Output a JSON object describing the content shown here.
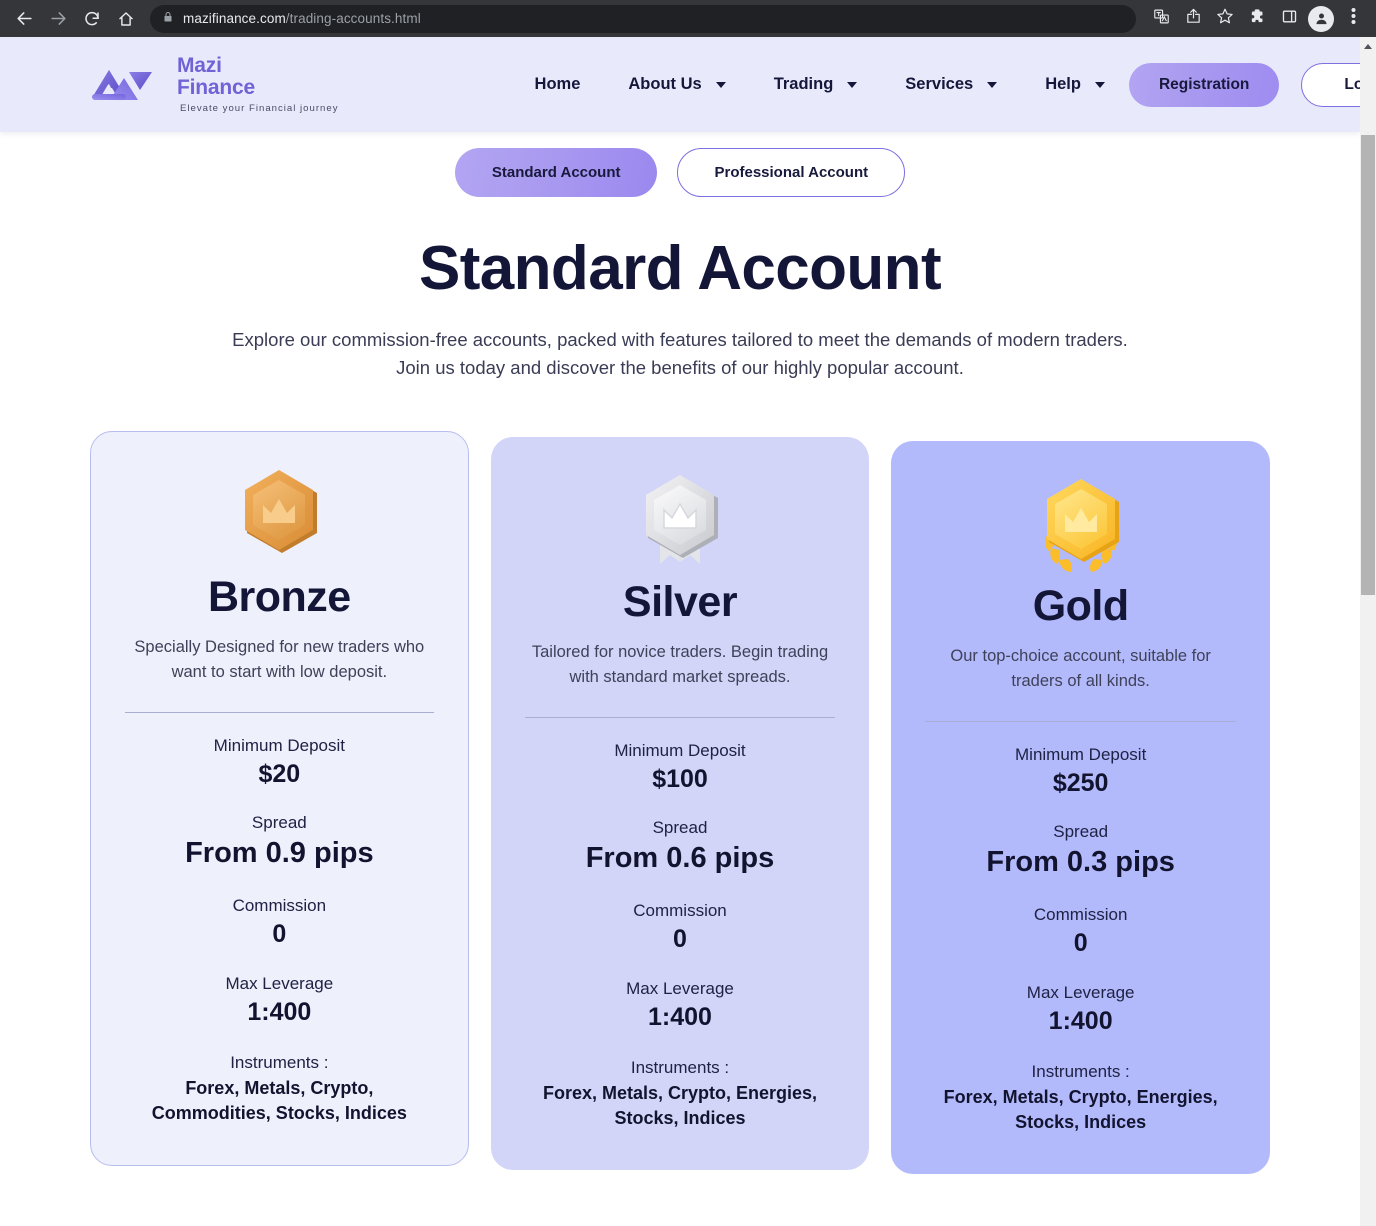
{
  "browser": {
    "url_domain": "mazifinance.com",
    "url_path": "/trading-accounts.html",
    "back_icon": "back-arrow-icon",
    "forward_icon": "forward-arrow-icon",
    "reload_icon": "reload-icon",
    "home_icon": "home-icon",
    "lock_icon": "lock-icon",
    "translate_icon": "translate-icon",
    "share_icon": "share-icon",
    "bookmark_icon": "bookmark-star-icon",
    "extensions_icon": "extensions-puzzle-icon",
    "sidepanel_icon": "side-panel-icon",
    "profile_icon": "profile-avatar-icon",
    "menu_icon": "three-dot-menu-icon"
  },
  "site_header": {
    "logo_line1": "Mazi",
    "logo_line2": "Finance",
    "tagline": "Elevate your Financial journey",
    "nav": [
      {
        "label": "Home",
        "has_caret": false
      },
      {
        "label": "About Us",
        "has_caret": true
      },
      {
        "label": "Trading",
        "has_caret": true
      },
      {
        "label": "Services",
        "has_caret": true
      },
      {
        "label": "Help",
        "has_caret": true
      }
    ],
    "registration_label": "Registration",
    "login_label": "Log In"
  },
  "account_tabs": [
    {
      "label": "Standard Account",
      "active": true
    },
    {
      "label": "Professional Account",
      "active": false
    }
  ],
  "hero": {
    "title": "Standard Account",
    "subtitle_line1": "Explore our commission-free accounts, packed with features tailored to meet the demands of modern traders.",
    "subtitle_line2": "Join us today and discover the benefits of our highly popular account."
  },
  "cards": [
    {
      "tier": "Bronze",
      "badge_icon": "bronze-hexagon-crown-badge-icon",
      "description": "Specially Designed for new traders who want to start with low deposit.",
      "min_deposit_label": "Minimum Deposit",
      "min_deposit_value": "$20",
      "spread_label": "Spread",
      "spread_value": "From 0.9 pips",
      "commission_label": "Commission",
      "commission_value": "0",
      "leverage_label": "Max Leverage",
      "leverage_value": "1:400",
      "instruments_label": "Instruments :",
      "instruments_value": "Forex, Metals, Crypto, Commodities, Stocks, Indices"
    },
    {
      "tier": "Silver",
      "badge_icon": "silver-hexagon-crown-ribbon-badge-icon",
      "description": "Tailored for novice traders. Begin trading with standard market spreads.",
      "min_deposit_label": "Minimum Deposit",
      "min_deposit_value": "$100",
      "spread_label": "Spread",
      "spread_value": "From 0.6 pips",
      "commission_label": "Commission",
      "commission_value": "0",
      "leverage_label": "Max Leverage",
      "leverage_value": "1:400",
      "instruments_label": "Instruments :",
      "instruments_value": "Forex, Metals, Crypto, Energies, Stocks, Indices"
    },
    {
      "tier": "Gold",
      "badge_icon": "gold-hexagon-crown-laurel-badge-icon",
      "description": "Our top-choice account, suitable for traders of all kinds.",
      "min_deposit_label": "Minimum Deposit",
      "min_deposit_value": "$250",
      "spread_label": "Spread",
      "spread_value": "From 0.3 pips",
      "commission_label": "Commission",
      "commission_value": "0",
      "leverage_label": "Max Leverage",
      "leverage_value": "1:400",
      "instruments_label": "Instruments :",
      "instruments_value": "Forex, Metals, Crypto, Energies, Stocks, Indices"
    }
  ],
  "colors": {
    "brand_purple": "#6f63d6",
    "accent_gradient_start": "#b3a5f2",
    "accent_gradient_end": "#9b88ef",
    "header_bg": "#e8eafc",
    "card_bronze_bg": "#eef0fc",
    "card_silver_bg": "#d3d5f8",
    "card_gold_bg": "#b2bafb",
    "heading_navy": "#141638",
    "chrome_bg": "#35363a",
    "omnibox_bg": "#202124"
  }
}
